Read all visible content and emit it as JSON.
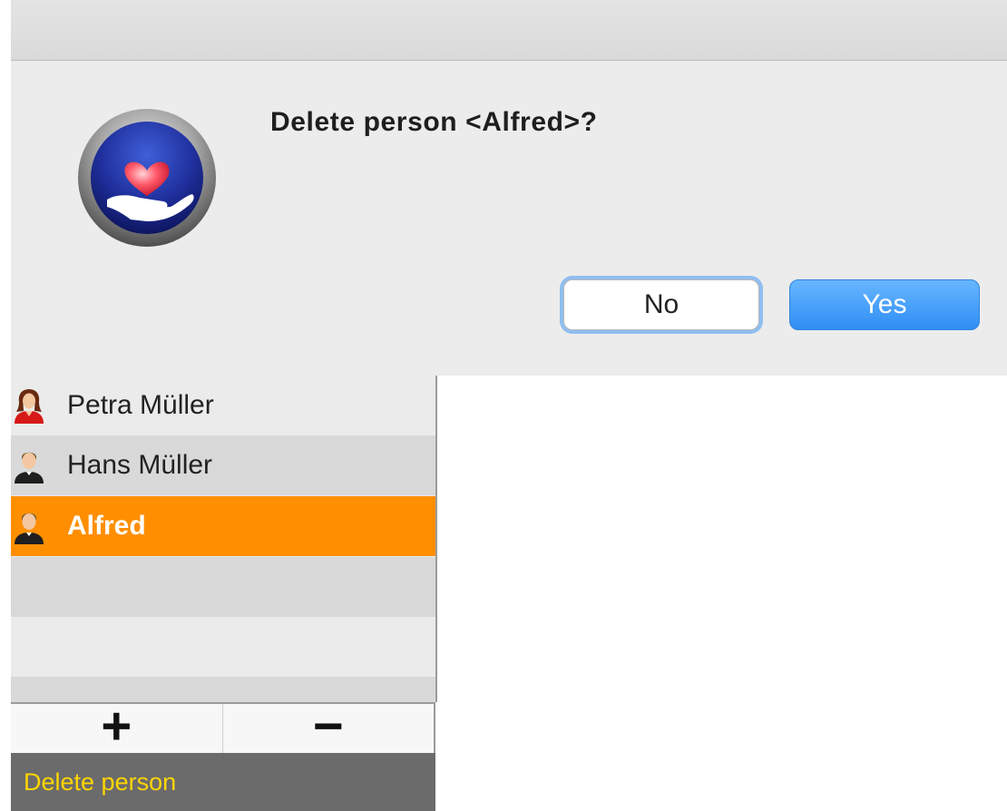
{
  "dialog": {
    "message": "Delete person <Alfred>?",
    "app_icon": "heart-in-hand-icon",
    "buttons": {
      "no": "No",
      "yes": "Yes"
    }
  },
  "person_list": {
    "items": [
      {
        "name": "Petra Müller",
        "icon": "female-person-icon",
        "selected": false
      },
      {
        "name": "Hans Müller",
        "icon": "male-person-icon",
        "selected": false
      },
      {
        "name": "Alfred",
        "icon": "male-person-icon",
        "selected": true
      }
    ],
    "selection_color": "#ff8f00"
  },
  "toolbar": {
    "add_label": "+",
    "remove_label": "−"
  },
  "status_bar": {
    "text": "Delete person",
    "text_color": "#ffd500"
  },
  "colors": {
    "primary_button": "#2f8ef4",
    "focus_ring": "#8fbef1"
  }
}
